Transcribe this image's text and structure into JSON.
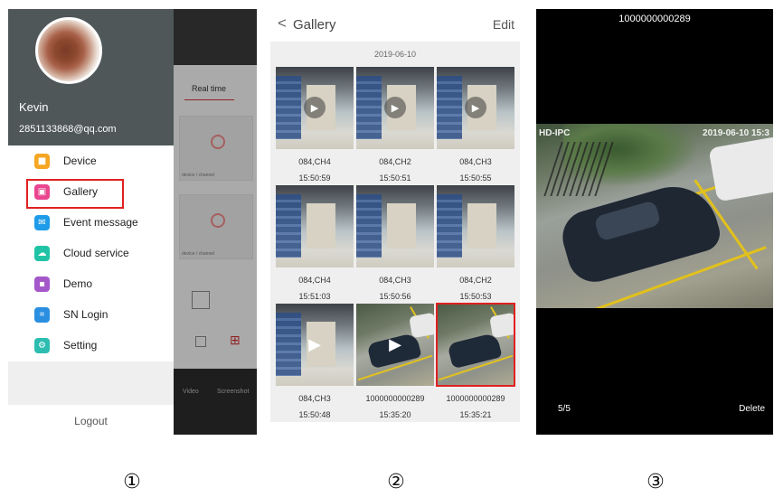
{
  "panel1": {
    "user": {
      "name": "Kevin",
      "email": "2851133868@qq.com"
    },
    "menu": [
      {
        "label": "Device",
        "icon": "camera-icon",
        "color": "#f5a623",
        "highlighted": false
      },
      {
        "label": "Gallery",
        "icon": "image-icon",
        "color": "#e9468f",
        "highlighted": true
      },
      {
        "label": "Event message",
        "icon": "message-icon",
        "color": "#1e9be9",
        "highlighted": false
      },
      {
        "label": "Cloud service",
        "icon": "cloud-icon",
        "color": "#20c3a5",
        "highlighted": false
      },
      {
        "label": "Demo",
        "icon": "demo-icon",
        "color": "#a457c9",
        "highlighted": false
      },
      {
        "label": "SN Login",
        "icon": "scan-icon",
        "color": "#2a8fe0",
        "highlighted": false
      },
      {
        "label": "Setting",
        "icon": "gear-icon",
        "color": "#2dbdb0",
        "highlighted": false
      }
    ],
    "logout_label": "Logout",
    "background_app": {
      "tab_label": "Real time",
      "card_label": "device / channel",
      "bottom_tabs": [
        "Video",
        "Screenshot"
      ]
    }
  },
  "panel2": {
    "title": "Gallery",
    "edit_label": "Edit",
    "date": "2019-06-10",
    "items": [
      {
        "name": "084,CH4",
        "time": "15:50:59",
        "scene": "warehouse",
        "video": true,
        "selected": false
      },
      {
        "name": "084,CH2",
        "time": "15:50:51",
        "scene": "warehouse",
        "video": true,
        "selected": false
      },
      {
        "name": "084,CH3",
        "time": "15:50:55",
        "scene": "warehouse",
        "video": true,
        "selected": false
      },
      {
        "name": "084,CH4",
        "time": "15:51:03",
        "scene": "warehouse",
        "video": false,
        "selected": false
      },
      {
        "name": "084,CH3",
        "time": "15:50:56",
        "scene": "warehouse",
        "video": false,
        "selected": false
      },
      {
        "name": "084,CH2",
        "time": "15:50:53",
        "scene": "warehouse",
        "video": false,
        "selected": false
      },
      {
        "name": "084,CH3",
        "time": "15:50:48",
        "scene": "warehouse",
        "video": true,
        "selected": false
      },
      {
        "name": "1000000000289",
        "time": "15:35:20",
        "scene": "parking",
        "video": true,
        "selected": false
      },
      {
        "name": "1000000000289",
        "time": "15:35:21",
        "scene": "parking",
        "video": false,
        "selected": true
      }
    ]
  },
  "panel3": {
    "title": "1000000000289",
    "overlay_left": "HD-IPC",
    "overlay_right": "2019-06-10  15:3",
    "counter": "5/5",
    "delete_label": "Delete"
  },
  "captions": [
    "①",
    "②",
    "③"
  ]
}
